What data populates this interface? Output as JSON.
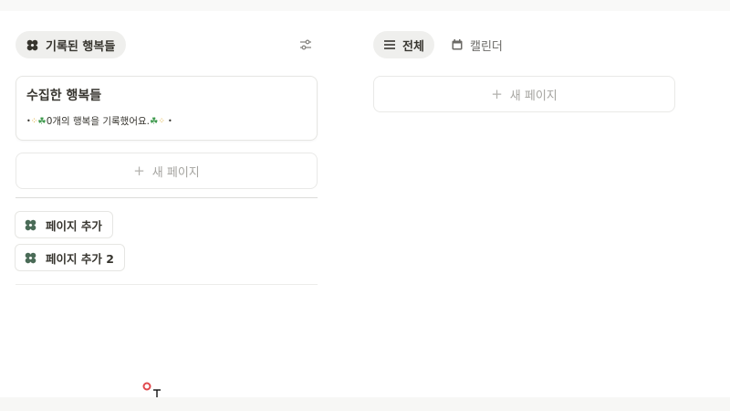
{
  "sidebar_view": {
    "chip_label": "기록된 행복들",
    "chip_icon": "clover-icon",
    "settings_icon": "sliders-icon"
  },
  "summary_card": {
    "title": "수집한 행복들",
    "line": "0개의 행복을 기록했어요."
  },
  "left_new_page": {
    "label": "새 페이지"
  },
  "pages": [
    {
      "label": "페이지 추가",
      "icon": "clover-icon"
    },
    {
      "label": "페이지 추가 2",
      "icon": "clover-icon"
    }
  ],
  "right_view": {
    "tabs": [
      {
        "label": "전체",
        "icon": "list-icon",
        "active": true
      },
      {
        "label": "캘린더",
        "icon": "calendar-icon",
        "active": false
      }
    ],
    "new_page_label": "새 페이지"
  },
  "colors": {
    "accent_green": "#3f9a4e",
    "clover_dark": "#4a6b57",
    "chip_bg": "#efefed"
  }
}
